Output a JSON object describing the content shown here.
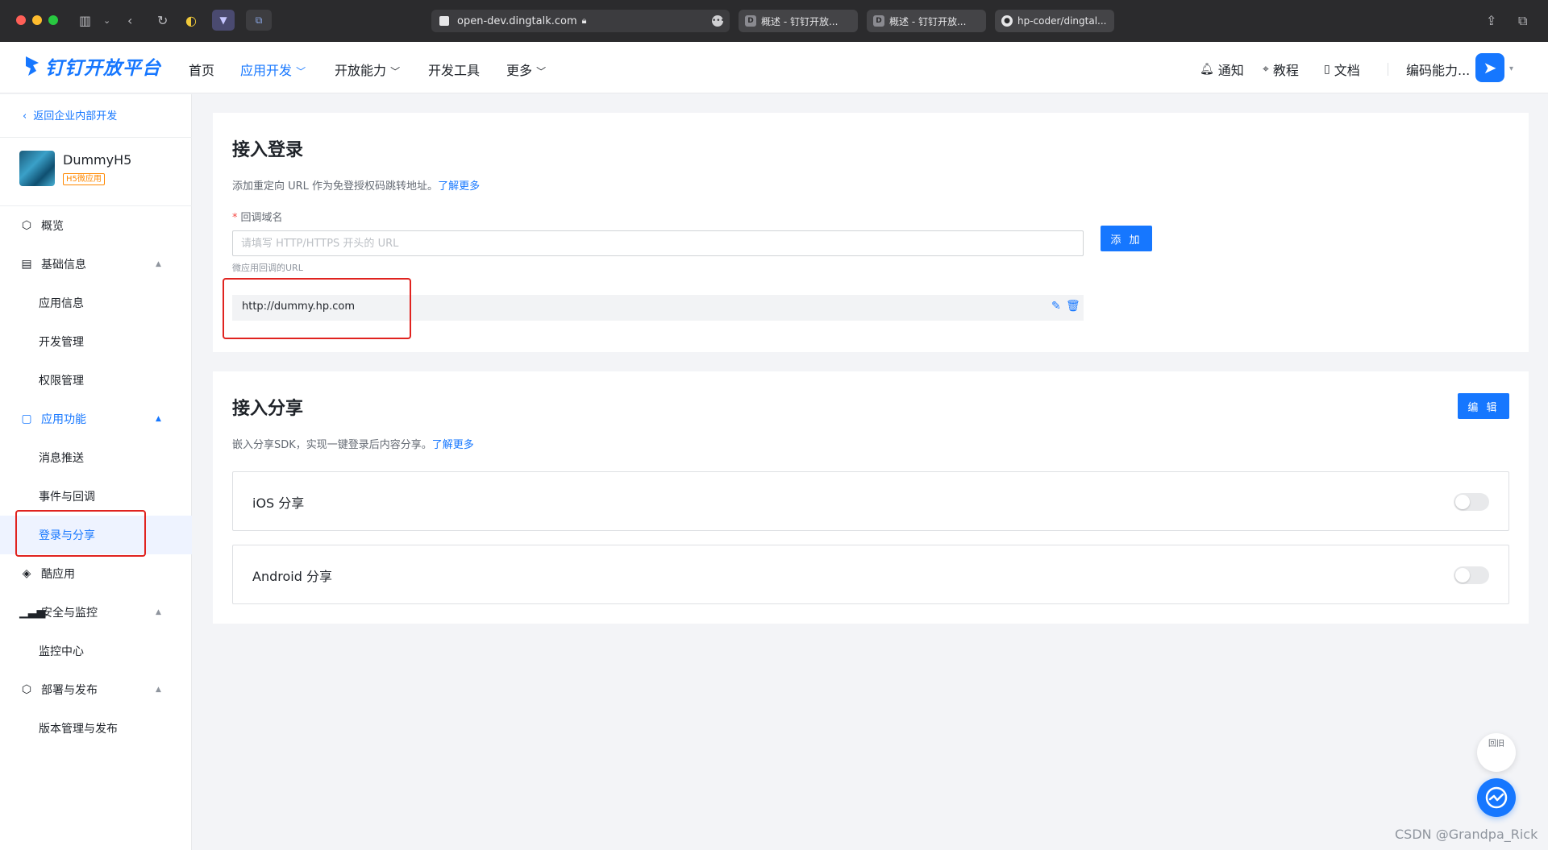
{
  "browser": {
    "url": "open-dev.dingtalk.com",
    "tabs": [
      "概述 - 钉钉开放...",
      "概述 - 钉钉开放...",
      "hp-coder/dingtal..."
    ]
  },
  "nav": {
    "logo": "钉钉开放平台",
    "items": [
      "首页",
      "应用开发",
      "开放能力",
      "开发工具",
      "更多"
    ],
    "right": [
      "通知",
      "教程",
      "文档"
    ],
    "user": "编码能力..."
  },
  "sidebar": {
    "back": "返回企业内部开发",
    "app_name": "DummyH5",
    "app_badge": "H5微应用",
    "items": {
      "overview": "概览",
      "basic": "基础信息",
      "app_info": "应用信息",
      "dev_manage": "开发管理",
      "perm_manage": "权限管理",
      "app_func": "应用功能",
      "msg_push": "消息推送",
      "event_callback": "事件与回调",
      "login_share": "登录与分享",
      "cool_app": "酷应用",
      "security": "安全与监控",
      "monitor_center": "监控中心",
      "deploy": "部署与发布",
      "version": "版本管理与发布"
    }
  },
  "login": {
    "title": "接入登录",
    "desc": "添加重定向 URL 作为免登授权码跳转地址。",
    "learn_more": "了解更多",
    "field_label": "回调域名",
    "placeholder": "请填写 HTTP/HTTPS 开头的 URL",
    "hint": "微应用回调的URL",
    "add_button": "添 加",
    "urls": [
      "http://dummy.hp.com"
    ]
  },
  "share": {
    "title": "接入分享",
    "desc": "嵌入分享SDK，实现一键登录后内容分享。",
    "learn_more": "了解更多",
    "edit_button": "编 辑",
    "ios": "iOS 分享",
    "android": "Android 分享",
    "ios_enabled": false,
    "android_enabled": false
  },
  "floating": {
    "back": "回旧"
  },
  "watermark": "CSDN @Grandpa_Rick",
  "colors": {
    "accent": "#1677ff",
    "highlight": "#e0231f"
  }
}
